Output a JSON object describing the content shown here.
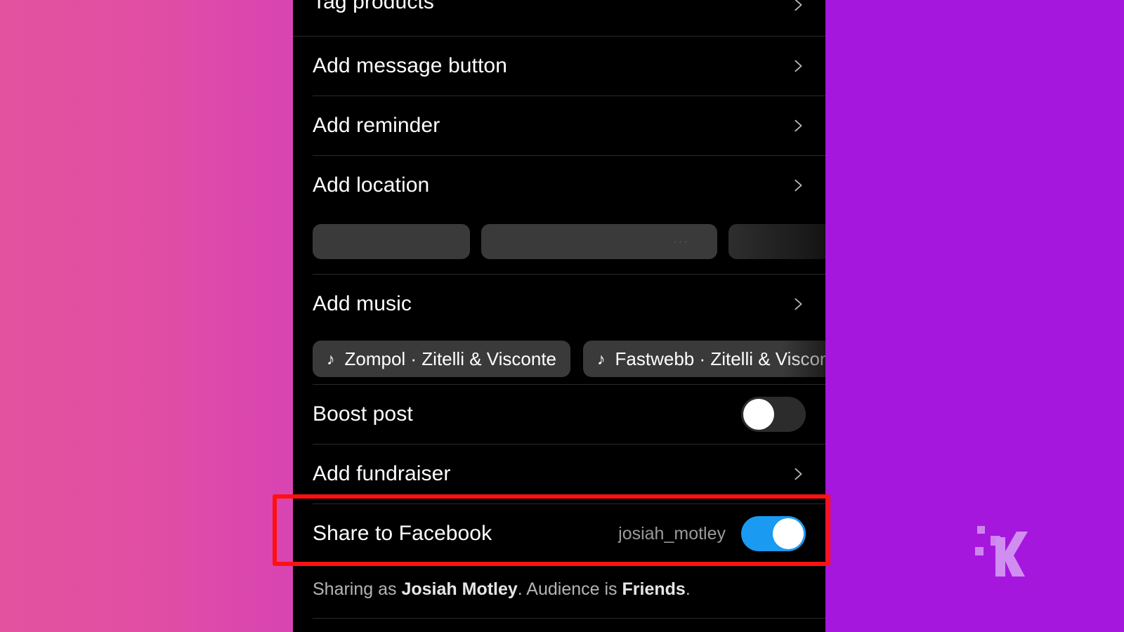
{
  "background": {
    "left_gradient_start": "#e2529f",
    "left_gradient_end": "#6e0f8d",
    "right_solid": "#a617de"
  },
  "highlight": {
    "color": "#ff1111",
    "target": "Share to Facebook"
  },
  "panel": {
    "background": "#000000",
    "rows": [
      {
        "id": "tag-products",
        "label": "Tag products",
        "accessory": "chevron",
        "cropped": true
      },
      {
        "id": "add-message-button",
        "label": "Add message button",
        "accessory": "chevron"
      },
      {
        "id": "add-reminder",
        "label": "Add reminder",
        "accessory": "chevron"
      },
      {
        "id": "add-location",
        "label": "Add location",
        "accessory": "chevron"
      },
      {
        "id": "add-music",
        "label": "Add music",
        "accessory": "chevron"
      },
      {
        "id": "boost-post",
        "label": "Boost post",
        "accessory": "toggle-off"
      },
      {
        "id": "add-fundraiser",
        "label": "Add fundraiser",
        "accessory": "chevron"
      },
      {
        "id": "share-to-facebook",
        "label": "Share to Facebook",
        "accessory": "toggle-on",
        "value": "josiah_motley"
      }
    ],
    "location_suggestions": {
      "redacted": true,
      "chips": [
        "",
        "",
        ""
      ],
      "overflow_indicator": "···"
    },
    "music_suggestions": {
      "icon": "music-note-icon",
      "chips": [
        "Zompol · Zitelli & Visconte",
        "Fastwebb · Zitelli & Visconte"
      ]
    },
    "toggles": {
      "boost_post_state": "off",
      "share_to_facebook_state": "on",
      "on_color": "#1a9af0",
      "off_color": "#2c2c2c",
      "knob_color": "#ffffff"
    },
    "share_account": "josiah_motley",
    "footnote": {
      "prefix": "Sharing as ",
      "name": "Josiah Motley",
      "middle": ". Audience is ",
      "audience": "Friends",
      "suffix": "."
    }
  },
  "watermark": {
    "letter": "K",
    "color": "#d9a6f5"
  }
}
